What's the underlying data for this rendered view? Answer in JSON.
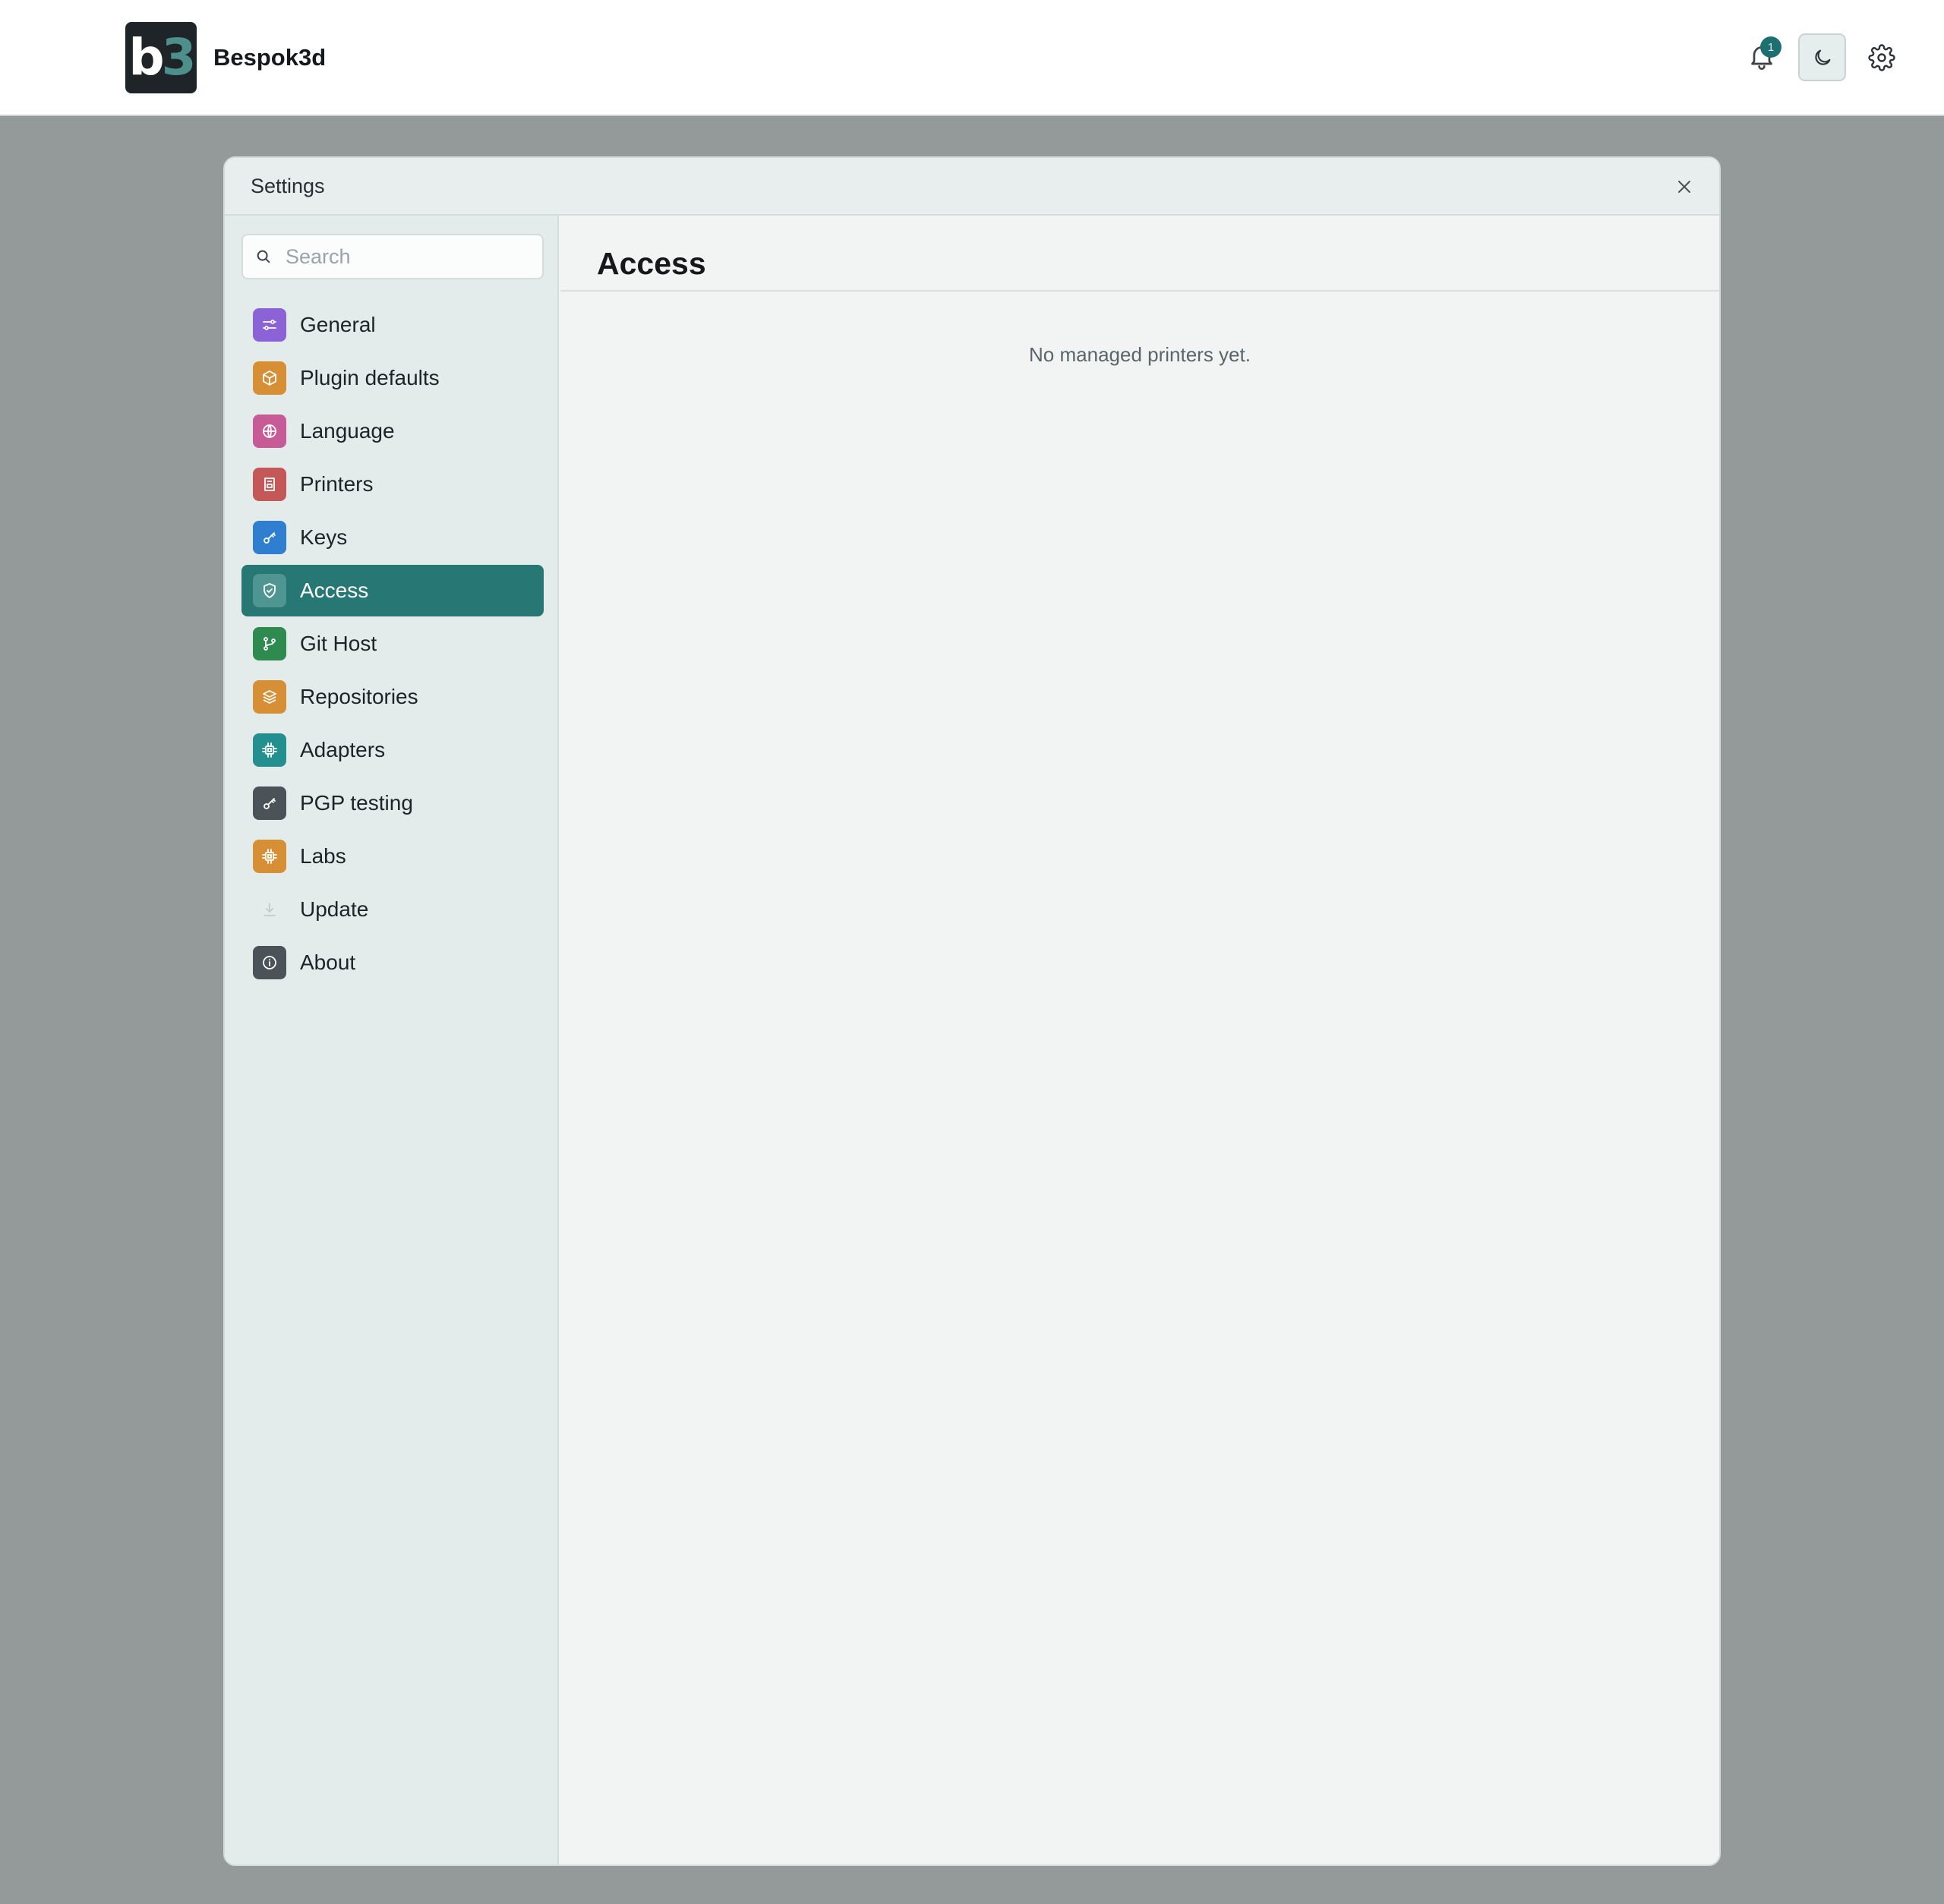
{
  "header": {
    "logo_text_main": "b",
    "logo_text_accent": "3",
    "brand_name": "Bespok3d",
    "notification_count": "1",
    "icons": [
      "bell-icon",
      "moon-icon",
      "gear-icon"
    ]
  },
  "modal": {
    "title": "Settings",
    "search_placeholder": "Search",
    "nav": [
      {
        "label": "General",
        "icon": "sliders-icon",
        "color": "#8b63d6"
      },
      {
        "label": "Plugin defaults",
        "icon": "box-icon",
        "color": "#d68f35"
      },
      {
        "label": "Language",
        "icon": "globe-icon",
        "color": "#c75b98"
      },
      {
        "label": "Printers",
        "icon": "printer-icon",
        "color": "#c45758"
      },
      {
        "label": "Keys",
        "icon": "key-icon",
        "color": "#2f7ed0"
      },
      {
        "label": "Access",
        "icon": "shield-icon",
        "color": "#4f9592",
        "active": true
      },
      {
        "label": "Git Host",
        "icon": "git-branch-icon",
        "color": "#2f8a4f"
      },
      {
        "label": "Repositories",
        "icon": "layers-icon",
        "color": "#d68f35"
      },
      {
        "label": "Adapters",
        "icon": "chip-icon",
        "color": "#23908f"
      },
      {
        "label": "PGP testing",
        "icon": "key-icon",
        "color": "#4b5258"
      },
      {
        "label": "Labs",
        "icon": "chip-icon",
        "color": "#d68f35"
      },
      {
        "label": "Update",
        "icon": "download-icon",
        "color": "transparent"
      },
      {
        "label": "About",
        "icon": "info-icon",
        "color": "#4b5258"
      }
    ],
    "content": {
      "title": "Access",
      "empty_message": "No managed printers yet."
    }
  },
  "colors": {
    "accent": "#277875",
    "backdrop": "#949a99"
  }
}
